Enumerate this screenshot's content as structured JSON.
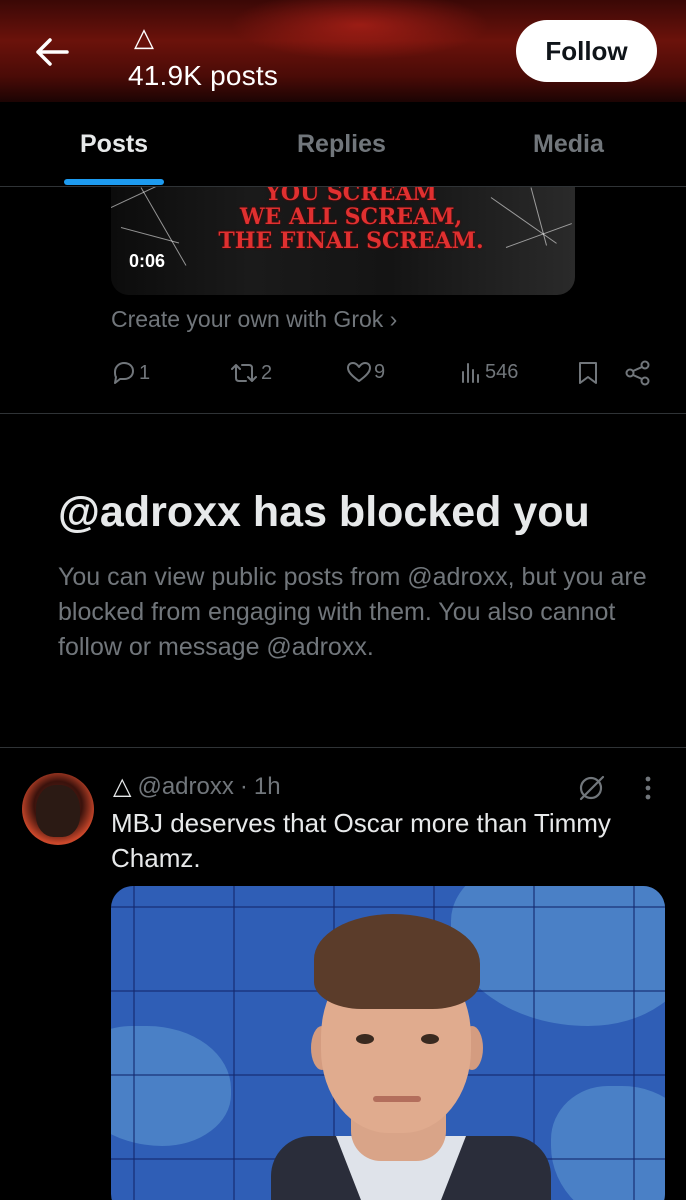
{
  "header": {
    "name_glyph": "△",
    "posts_count": "41.9K posts",
    "follow_label": "Follow"
  },
  "tabs": [
    {
      "label": "Posts",
      "active": true
    },
    {
      "label": "Replies",
      "active": false
    },
    {
      "label": "Media",
      "active": false
    }
  ],
  "previous_post": {
    "video_text_lines": [
      "YOU SCREAM",
      "WE ALL SCREAM,",
      "THE FINAL SCREAM."
    ],
    "video_duration": "0:06",
    "grok_link": "Create your own with Grok",
    "grok_chevron": "›",
    "actions": {
      "reply_count": "1",
      "repost_count": "2",
      "like_count": "9",
      "view_count": "546"
    }
  },
  "blocked": {
    "title": "@adroxx has blocked you",
    "message": "You can view public posts from @adroxx, but you are blocked from engaging with them. You also cannot follow or message @adroxx."
  },
  "tweet": {
    "name_glyph": "△",
    "handle": "@adroxx",
    "separator": "·",
    "time": "1h",
    "text": "MBJ deserves that Oscar more than Timmy Chamz."
  },
  "colors": {
    "accent": "#1d9bf0",
    "muted": "#71767b",
    "text": "#e7e9ea",
    "background": "#000000"
  },
  "icons": [
    "back-arrow-icon",
    "reply-icon",
    "repost-icon",
    "like-icon",
    "views-icon",
    "bookmark-icon",
    "share-icon",
    "grok-icon",
    "more-options-icon"
  ]
}
